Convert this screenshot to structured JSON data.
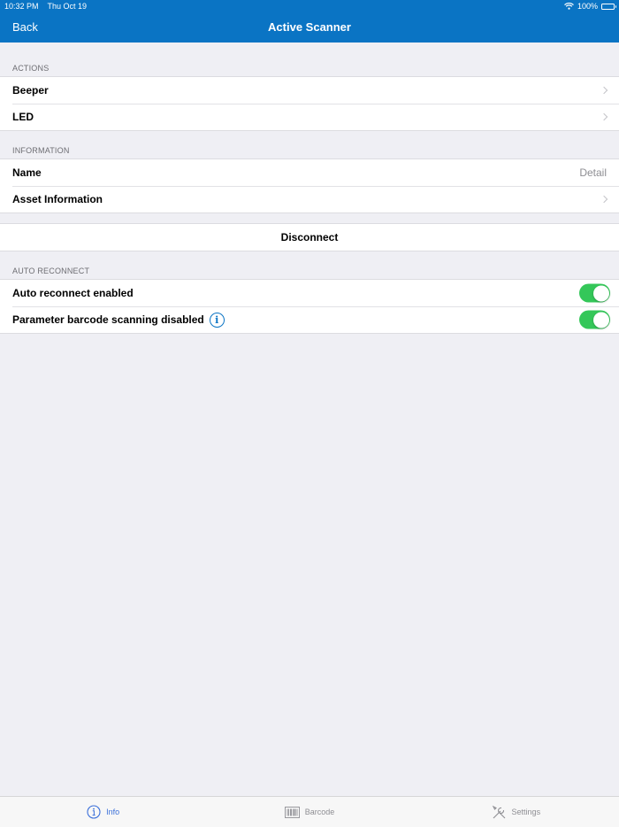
{
  "status_bar": {
    "time": "10:32 PM",
    "date": "Thu Oct 19",
    "battery": "100%"
  },
  "nav": {
    "back_label": "Back",
    "title": "Active Scanner"
  },
  "actions": {
    "header": "ACTIONS",
    "items": [
      {
        "label": "Beeper"
      },
      {
        "label": "LED"
      }
    ]
  },
  "information": {
    "header": "INFORMATION",
    "name_label": "Name",
    "name_detail": "Detail",
    "asset_label": "Asset Information"
  },
  "disconnect_label": "Disconnect",
  "auto_reconnect": {
    "header": "AUTO RECONNECT",
    "enabled_label": "Auto reconnect enabled",
    "enabled_value": true,
    "param_label": "Parameter barcode scanning disabled",
    "param_value": true
  },
  "tabs": [
    {
      "label": "Info",
      "icon": "info-icon",
      "active": true
    },
    {
      "label": "Barcode",
      "icon": "barcode-icon",
      "active": false
    },
    {
      "label": "Settings",
      "icon": "tools-icon",
      "active": false
    }
  ],
  "colors": {
    "accent": "#0a74c4",
    "toggle_on": "#34c759",
    "tab_active": "#3a6fd9"
  }
}
